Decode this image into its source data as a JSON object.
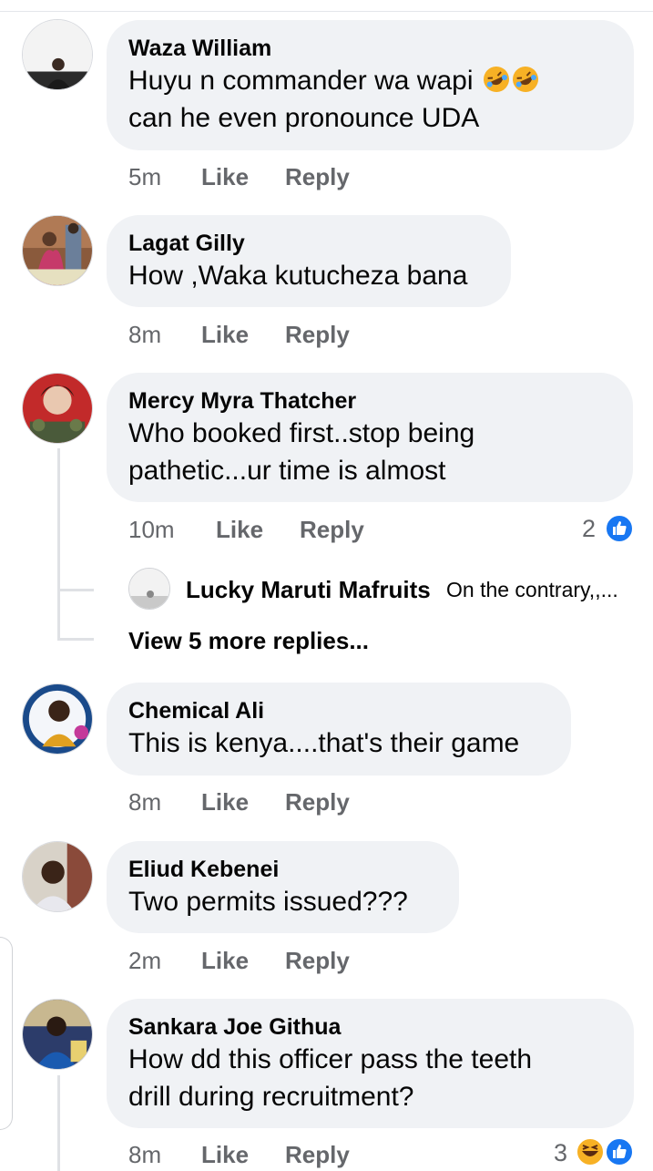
{
  "comments": [
    {
      "name": "Waza William",
      "text_lines": [
        "Huyu n commander wa wapi",
        "can he even pronounce UDA"
      ],
      "emoji": [
        "rolling-on-floor-laughing",
        "rolling-on-floor-laughing"
      ],
      "time": "5m",
      "like": "Like",
      "reply": "Reply"
    },
    {
      "name": "Lagat Gilly",
      "text_lines": [
        "How ,Waka kutucheza bana"
      ],
      "time": "8m",
      "like": "Like",
      "reply": "Reply"
    },
    {
      "name": "Mercy Myra Thatcher",
      "text_lines": [
        "Who booked first..stop being",
        "pathetic...ur time is almost"
      ],
      "time": "10m",
      "like": "Like",
      "reply": "Reply",
      "reactions": {
        "count": "2",
        "icons": [
          "like-icon"
        ]
      },
      "reply_preview": {
        "name": "Lucky Maruti Mafruits",
        "snippet": "On the contrary,,..."
      },
      "more_replies": "View 5 more replies..."
    },
    {
      "name": "Chemical Ali",
      "text_lines": [
        "This is kenya....that's their game"
      ],
      "time": "8m",
      "like": "Like",
      "reply": "Reply"
    },
    {
      "name": "Eliud Kebenei",
      "text_lines": [
        "Two permits issued???"
      ],
      "time": "2m",
      "like": "Like",
      "reply": "Reply"
    },
    {
      "name": "Sankara Joe Githua",
      "text_lines": [
        "How dd this officer pass the teeth",
        "drill during recruitment?"
      ],
      "time": "8m",
      "like": "Like",
      "reply": "Reply",
      "reactions": {
        "count": "3",
        "icons": [
          "haha-icon",
          "like-icon"
        ]
      }
    }
  ],
  "colors": {
    "bubble": "#f0f2f5",
    "meta": "#65676b",
    "like_blue": "#1877f2",
    "haha_yellow": "#f7b125"
  }
}
